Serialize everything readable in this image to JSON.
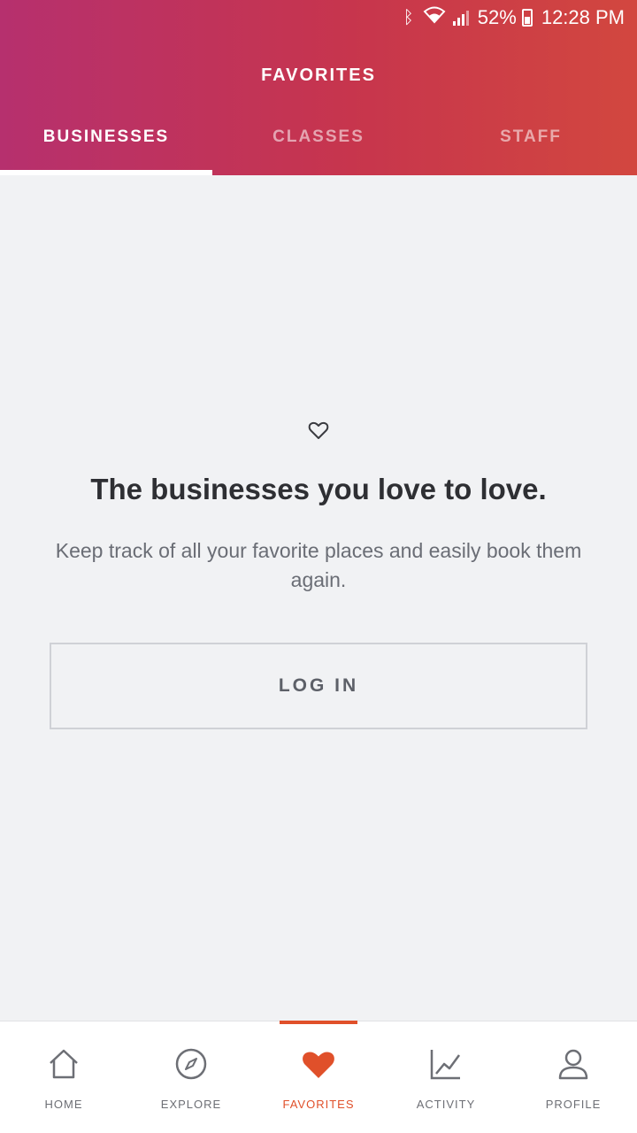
{
  "status_bar": {
    "battery": "52%",
    "time": "12:28 PM"
  },
  "header": {
    "title": "FAVORITES",
    "tabs": [
      {
        "label": "BUSINESSES",
        "active": true
      },
      {
        "label": "CLASSES",
        "active": false
      },
      {
        "label": "STAFF",
        "active": false
      }
    ]
  },
  "empty_state": {
    "title": "The businesses you love to love.",
    "description": "Keep track of all your favorite places and easily book them again.",
    "button_label": "LOG IN"
  },
  "bottom_nav": {
    "items": [
      {
        "label": "HOME",
        "icon": "home-icon"
      },
      {
        "label": "EXPLORE",
        "icon": "compass-icon"
      },
      {
        "label": "FAVORITES",
        "icon": "heart-icon"
      },
      {
        "label": "ACTIVITY",
        "icon": "activity-icon"
      },
      {
        "label": "PROFILE",
        "icon": "profile-icon"
      }
    ],
    "active_color": "#e0502a"
  }
}
